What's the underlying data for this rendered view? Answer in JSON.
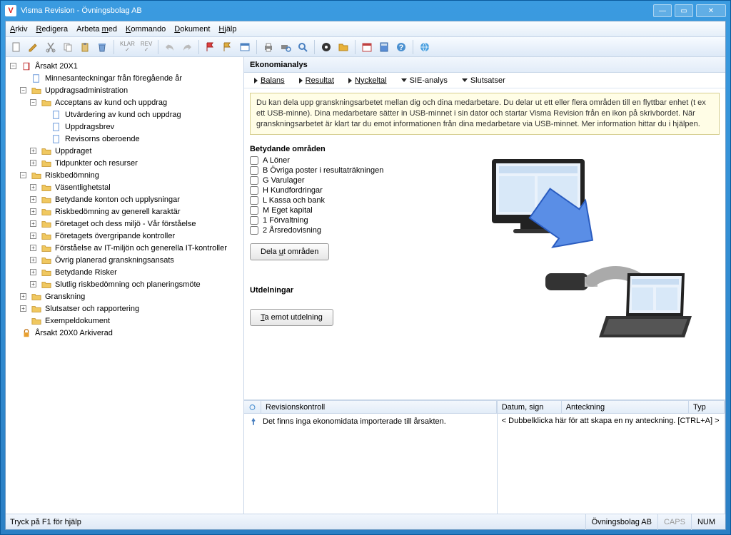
{
  "window": {
    "title": "Visma Revision - Övningsbolag AB"
  },
  "menu": {
    "arkiv": "Arkiv",
    "redigera": "Redigera",
    "arbeta_med": "Arbeta med",
    "kommando": "Kommando",
    "dokument": "Dokument",
    "hjalp": "Hjälp"
  },
  "tree": {
    "root": "Årsakt 20X1",
    "n1": "Minnesanteckningar från föregående år",
    "n2": "Uppdragsadministration",
    "n2a": "Acceptans av kund och uppdrag",
    "n2a1": "Utvärdering av kund och uppdrag",
    "n2a2": "Uppdragsbrev",
    "n2a3": "Revisorns oberoende",
    "n2b": "Uppdraget",
    "n2c": "Tidpunkter och resurser",
    "n3": "Riskbedömning",
    "n3a": "Väsentlighetstal",
    "n3b": "Betydande konton och upplysningar",
    "n3c": "Riskbedömning av generell karaktär",
    "n3d": "Företaget och dess miljö - Vår förståelse",
    "n3e": "Företagets övergripande kontroller",
    "n3f": "Förståelse av IT-miljön och generella IT-kontroller",
    "n3g": "Övrig planerad granskningsansats",
    "n3h": "Betydande Risker",
    "n3i": "Slutlig riskbedömning och planeringsmöte",
    "n4": "Granskning",
    "n5": "Slutsatser och rapportering",
    "n6": "Exempeldokument",
    "arch": "Årsakt 20X0 Arkiverad"
  },
  "panel": {
    "title": "Ekonomianalys",
    "tabs": {
      "balans": "Balans",
      "resultat": "Resultat",
      "nyckeltal": "Nyckeltal",
      "sie": "SIE-analys",
      "slutsatser": "Slutsatser"
    },
    "info": "Du kan dela upp granskningsarbetet mellan dig och dina medarbetare. Du delar ut ett eller flera områden till en flyttbar enhet (t ex ett USB-minne). Dina medarbetare sätter in USB-minnet i sin dator och startar Visma Revision från en ikon på skrivbordet. När granskningsarbetet är klart tar du emot informationen från dina medarbetare via USB-minnet. Mer information hittar du i hjälpen.",
    "areas_title": "Betydande områden",
    "areas": [
      "A Löner",
      "B Övriga poster i resultaträkningen",
      "G Varulager",
      "H Kundfordringar",
      "L Kassa och bank",
      "M Eget kapital",
      "1 Förvaltning",
      "2 Årsredovisning"
    ],
    "btn_dela": "Dela ut områden",
    "utdel_title": "Utdelningar",
    "btn_ta": "Ta emot utdelning"
  },
  "bottom": {
    "left_header": "Revisionskontroll",
    "left_msg": "Det finns inga ekonomidata importerade till årsakten.",
    "r_col1": "Datum, sign",
    "r_col2": "Anteckning",
    "r_col3": "Typ",
    "r_hint": "< Dubbelklicka här för att skapa en ny anteckning. [CTRL+A] >"
  },
  "status": {
    "help": "Tryck på F1 för hjälp",
    "company": "Övningsbolag AB",
    "caps": "CAPS",
    "num": "NUM"
  }
}
